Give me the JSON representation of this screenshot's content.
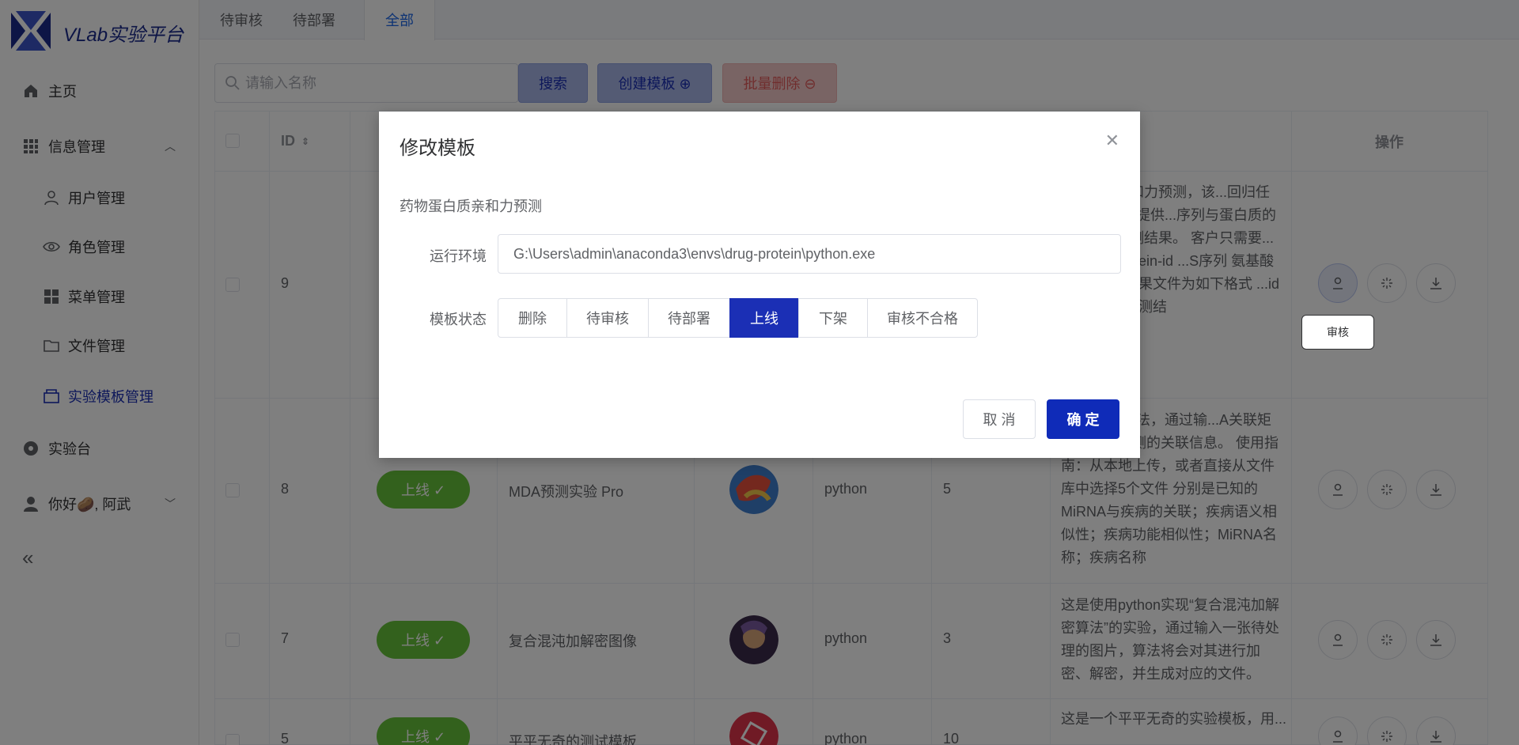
{
  "app": {
    "brand": "VLab实验平台"
  },
  "sidebar": {
    "items": [
      {
        "label": "主页"
      },
      {
        "label": "信息管理"
      },
      {
        "label": "用户管理"
      },
      {
        "label": "角色管理"
      },
      {
        "label": "菜单管理"
      },
      {
        "label": "文件管理"
      },
      {
        "label": "实验模板管理"
      },
      {
        "label": "实验台"
      },
      {
        "label": "你好🥔, 阿武"
      }
    ]
  },
  "tabs": [
    "待审核",
    "待部署",
    "全部"
  ],
  "toolbar": {
    "search_placeholder": "请输入名称",
    "search_label": "搜索",
    "create_label": "创建模板 ⊕",
    "delete_label": "批量删除 ⊖"
  },
  "table": {
    "headers": {
      "id": "ID",
      "ops": "操作"
    },
    "rows": [
      {
        "id": "9",
        "status": "",
        "name": "",
        "lang": "",
        "count": "",
        "desc": "...蛋白质亲和力预测，该...回归任务。 只需要提供...序列与蛋白质的氨基酸...预测结果。 客户只需要... “drug-id protein-id ...S序列 氨基酸序列”的... 结果文件为如下格式 ...id protein-id 预测结"
      },
      {
        "id": "8",
        "status": "上线 ✓",
        "name": "MDA预测实验 Pro",
        "lang": "python",
        "count": "5",
        "desc": "...NRLMF算法，通过输...A关联矩阵，得到预测的关联信息。 使用指南：从本地上传，或者直接从文件库中选择5个文件 分别是已知的MiRNA与疾病的关联；疾病语义相似性；疾病功能相似性；MiRNA名称；疾病名称"
      },
      {
        "id": "7",
        "status": "上线 ✓",
        "name": "复合混沌加解密图像",
        "lang": "python",
        "count": "3",
        "desc": "这是使用python实现“复合混沌加解密算法”的实验，通过输入一张待处理的图片，算法将会对其进行加密、解密，并生成对应的文件。"
      },
      {
        "id": "5",
        "status": "上线 ✓",
        "name": "平平无奇的测试模板",
        "lang": "python",
        "count": "10",
        "desc": "这是一个平平无奇的实验模板，用..."
      }
    ]
  },
  "tooltip": "审核",
  "dialog": {
    "title": "修改模板",
    "subtitle": "药物蛋白质亲和力预测",
    "env_label": "运行环境",
    "env_value": "G:\\Users\\admin\\anaconda3\\envs\\drug-protein\\python.exe",
    "status_label": "模板状态",
    "status_options": [
      "删除",
      "待审核",
      "待部署",
      "上线",
      "下架",
      "审核不合格"
    ],
    "status_selected": "上线",
    "cancel_label": "取 消",
    "ok_label": "确 定"
  },
  "colors": {
    "accent": "#1b2fb5",
    "online": "#67c23a",
    "danger": "#e05a5a"
  }
}
